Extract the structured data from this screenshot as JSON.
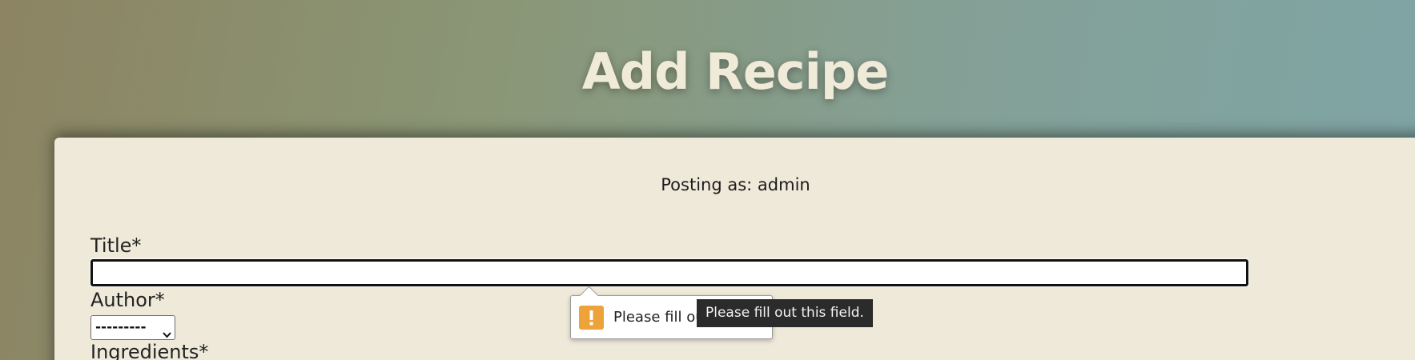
{
  "header": {
    "title": "Add Recipe"
  },
  "form": {
    "posting_as": "Posting as: admin",
    "title_label": "Title*",
    "title_value": "",
    "author_label": "Author*",
    "author_selected": "---------",
    "ingredients_label": "Ingredients*"
  },
  "validation": {
    "bubble_text": "Please fill out this field.",
    "tooltip_text": "Please fill out this field.",
    "warning_icon": "exclamation-icon"
  },
  "colors": {
    "card_background": "#eee9d9",
    "title_color": "#f0ead8",
    "warning_accent": "#eda33a",
    "tooltip_background": "#2b2b2b"
  }
}
